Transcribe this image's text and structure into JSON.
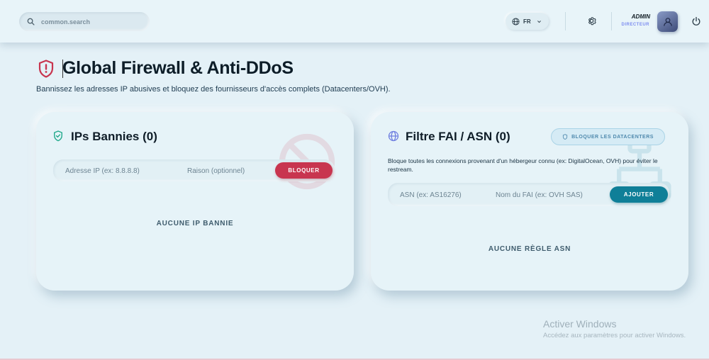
{
  "header": {
    "search_placeholder": "common.search",
    "language": "FR",
    "user_name": "ADMIN",
    "user_role": "DIRECTEUR"
  },
  "page": {
    "title": "Global Firewall & Anti-DDoS",
    "subtitle": "Bannissez les adresses IP abusives et bloquez des fournisseurs d'accès complets (Datacenters/OVH)."
  },
  "banned_ips": {
    "title": "IPs Bannies (0)",
    "ip_placeholder": "Adresse IP (ex: 8.8.8.8)",
    "reason_placeholder": "Raison (optionnel)",
    "block_label": "BLOQUER",
    "empty_label": "AUCUNE IP BANNIE"
  },
  "asn_filter": {
    "title": "Filtre FAI / ASN (0)",
    "block_datacenters_label": "BLOQUER LES DATACENTERS",
    "description": "Bloque toutes les connexions provenant d'un hébergeur connu (ex: DigitalOcean, OVH) pour éviter le restream.",
    "asn_placeholder": "ASN (ex: AS16276)",
    "isp_placeholder": "Nom du FAI (ex: OVH SAS)",
    "add_label": "AJOUTER",
    "empty_label": "AUCUNE RÈGLE ASN"
  },
  "windows_watermark": {
    "title": "Activer Windows",
    "subtitle": "Accédez aux paramètres pour activer Windows."
  },
  "colors": {
    "accent_red": "#c8354f",
    "accent_teal": "#0f7f98",
    "shield_green": "#1fa88a",
    "globe_purple": "#6f7fe0",
    "background": "#e4f1f7"
  },
  "icons": [
    "search-icon",
    "globe-icon",
    "chevron-down-icon",
    "gear-icon",
    "power-icon",
    "shield-alert-icon",
    "shield-check-icon",
    "ban-icon",
    "network-icon"
  ]
}
